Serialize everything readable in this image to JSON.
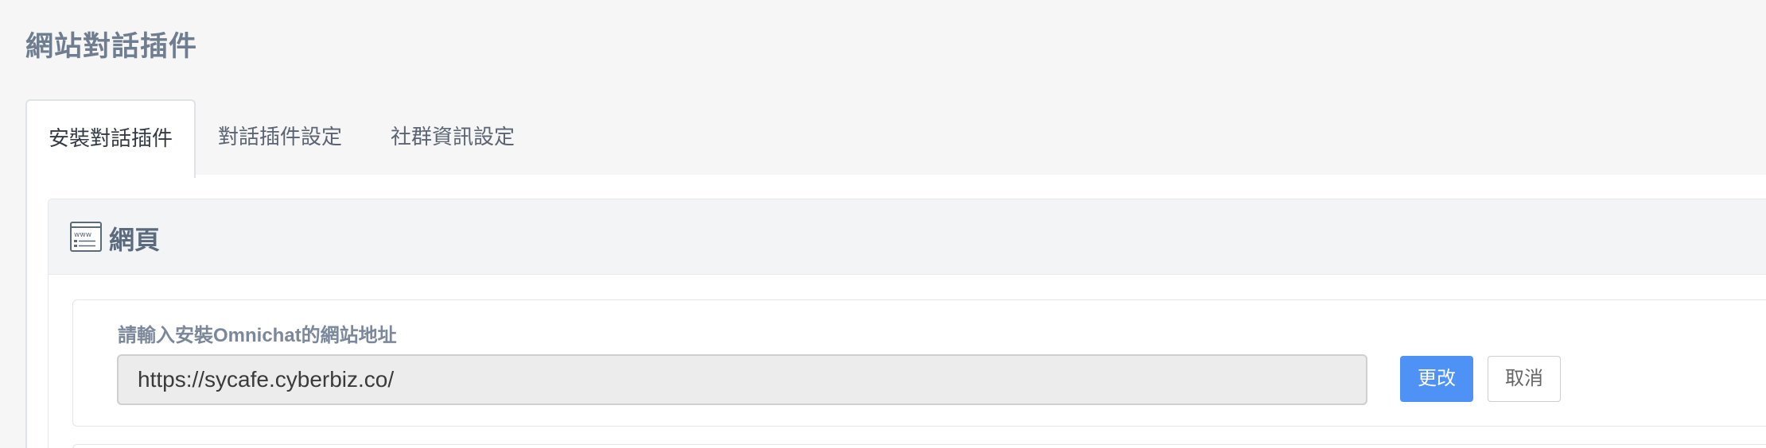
{
  "page": {
    "title": "網站對話插件"
  },
  "tabs": [
    {
      "label": "安裝對話插件",
      "active": true
    },
    {
      "label": "對話插件設定",
      "active": false
    },
    {
      "label": "社群資訊設定",
      "active": false
    }
  ],
  "section": {
    "icon": "web-page-icon",
    "title": "網頁"
  },
  "website_field": {
    "label": "請輸入安裝Omnichat的網站地址",
    "value": "https://sycafe.cyberbiz.co/",
    "change_label": "更改",
    "cancel_label": "取消"
  },
  "colors": {
    "primary": "#4f92f5",
    "title_text": "#6f7d91",
    "page_bg": "#f6f6f6",
    "input_bg": "#ececec"
  }
}
